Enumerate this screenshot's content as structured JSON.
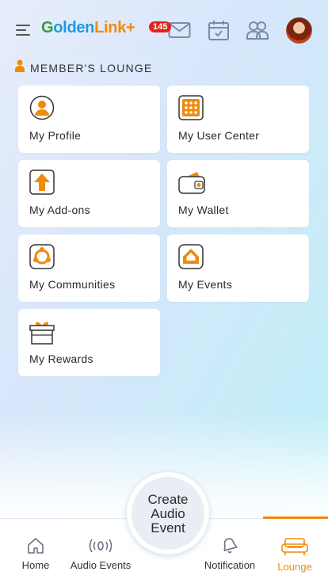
{
  "header": {
    "logo": {
      "part1": "G",
      "part2": "olden",
      "part3": "Link+"
    },
    "mail_badge": "145",
    "icons": [
      "menu-icon",
      "mail-icon",
      "calendar-icon",
      "users-icon",
      "avatar"
    ]
  },
  "section": {
    "title": "MEMBER'S LOUNGE",
    "icon": "person-icon"
  },
  "tiles": [
    {
      "label": "My Profile",
      "icon": "profile-icon"
    },
    {
      "label": "My User Center",
      "icon": "grid-icon"
    },
    {
      "label": "My Add-ons",
      "icon": "upload-arrow-icon"
    },
    {
      "label": "My Wallet",
      "icon": "wallet-icon"
    },
    {
      "label": "My Communities",
      "icon": "community-icon"
    },
    {
      "label": "My Events",
      "icon": "event-home-icon"
    },
    {
      "label": "My Rewards",
      "icon": "gift-icon"
    }
  ],
  "create_button": {
    "line1": "Create",
    "line2": "Audio",
    "line3": "Event"
  },
  "nav": [
    {
      "label": "Home",
      "icon": "home-icon"
    },
    {
      "label": "Audio Events",
      "icon": "broadcast-icon"
    },
    {
      "label": "Notification",
      "icon": "bell-icon"
    },
    {
      "label": "Lounge",
      "icon": "sofa-icon",
      "active": true
    }
  ],
  "colors": {
    "accent": "#f08a0a",
    "badge": "#e2231a",
    "text": "#2a2a2a"
  }
}
